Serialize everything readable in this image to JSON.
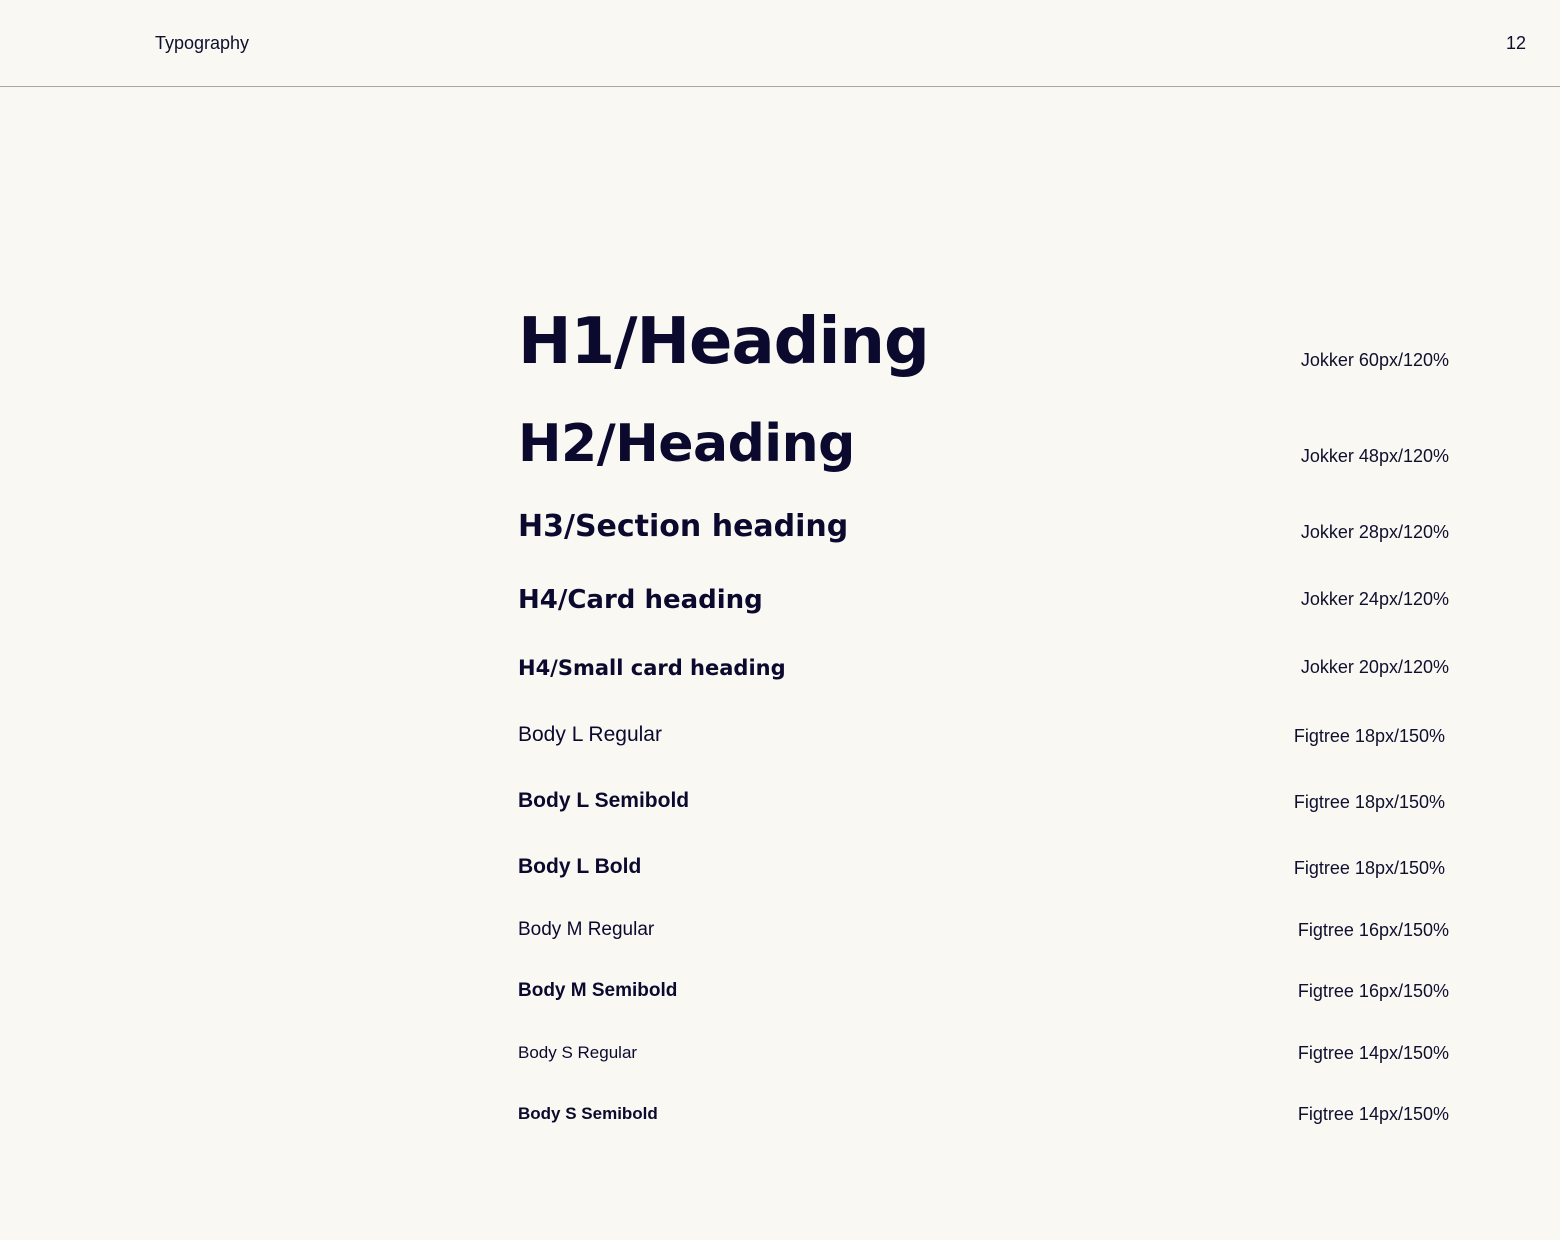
{
  "header": {
    "section_title": "Typography",
    "page_number": "12"
  },
  "colors": {
    "background": "#FAF8F3",
    "text": "#0B0A2E",
    "divider": "#A8A8A8"
  },
  "styles": [
    {
      "name": "H1/Heading",
      "spec": "Jokker 60px/120%"
    },
    {
      "name": "H2/Heading",
      "spec": "Jokker 48px/120%"
    },
    {
      "name": "H3/Section heading",
      "spec": "Jokker 28px/120%"
    },
    {
      "name": "H4/Card heading",
      "spec": "Jokker 24px/120%"
    },
    {
      "name": "H4/Small card heading",
      "spec": "Jokker 20px/120%"
    },
    {
      "name": "Body L Regular",
      "spec": "Figtree 18px/150%"
    },
    {
      "name": "Body L Semibold",
      "spec": "Figtree 18px/150%"
    },
    {
      "name": "Body L Bold",
      "spec": "Figtree 18px/150%"
    },
    {
      "name": "Body M Regular",
      "spec": "Figtree 16px/150%"
    },
    {
      "name": "Body M Semibold",
      "spec": "Figtree 16px/150%"
    },
    {
      "name": "Body S Regular",
      "spec": "Figtree 14px/150%"
    },
    {
      "name": "Body S Semibold",
      "spec": "Figtree 14px/150%"
    }
  ]
}
